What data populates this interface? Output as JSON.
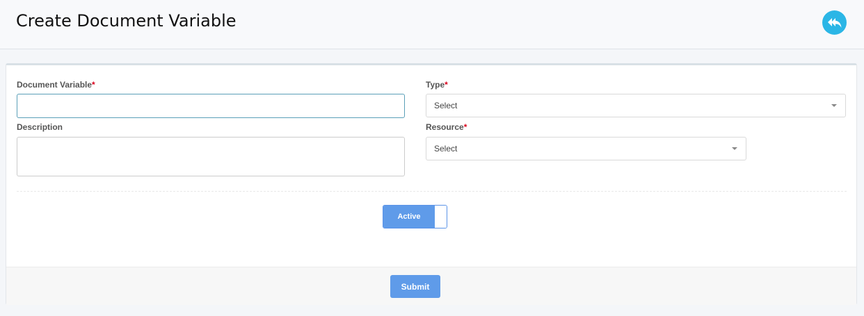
{
  "header": {
    "title": "Create Document Variable",
    "back_icon": "reply-all-icon",
    "accent_color": "#2bb6e6"
  },
  "form": {
    "document_variable": {
      "label": "Document Variable",
      "required_mark": "*",
      "value": ""
    },
    "type": {
      "label": "Type",
      "required_mark": "*",
      "selected": "Select"
    },
    "description": {
      "label": "Description",
      "value": ""
    },
    "resource": {
      "label": "Resource",
      "required_mark": "*",
      "selected": "Select"
    },
    "status_toggle": {
      "label": "Active",
      "on": true
    }
  },
  "footer": {
    "submit_label": "Submit",
    "button_color": "#5f9be9"
  }
}
